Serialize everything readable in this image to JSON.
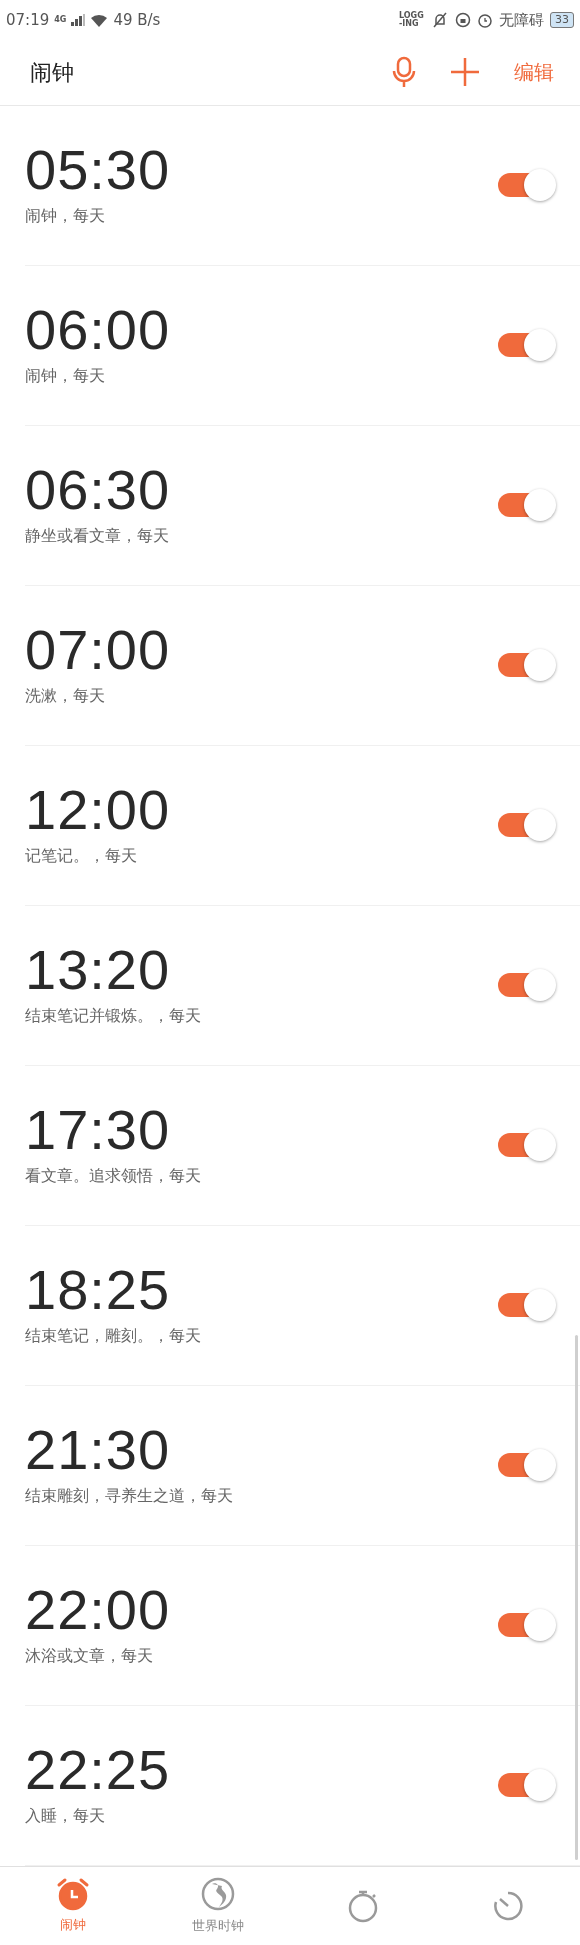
{
  "status_bar": {
    "time": "07:19",
    "network": "4G",
    "speed": "49 B/s",
    "logging": "LOGG-ING",
    "accessibility": "无障碍",
    "battery": "33"
  },
  "header": {
    "title": "闹钟",
    "edit": "编辑"
  },
  "alarms": [
    {
      "time": "05:30",
      "label": "闹钟，每天",
      "on": true
    },
    {
      "time": "06:00",
      "label": "闹钟，每天",
      "on": true
    },
    {
      "time": "06:30",
      "label": "静坐或看文章，每天",
      "on": true
    },
    {
      "time": "07:00",
      "label": "洗漱，每天",
      "on": true
    },
    {
      "time": "12:00",
      "label": "记笔记。，每天",
      "on": true
    },
    {
      "time": "13:20",
      "label": "结束笔记并锻炼。，每天",
      "on": true
    },
    {
      "time": "17:30",
      "label": "看文章。追求领悟，每天",
      "on": true
    },
    {
      "time": "18:25",
      "label": "结束笔记，雕刻。，每天",
      "on": true
    },
    {
      "time": "21:30",
      "label": "结束雕刻，寻养生之道，每天",
      "on": true
    },
    {
      "time": "22:00",
      "label": "沐浴或文章，每天",
      "on": true
    },
    {
      "time": "22:25",
      "label": "入睡，每天",
      "on": true
    }
  ],
  "tabs": [
    {
      "kind": "alarm",
      "label": "闹钟",
      "selected": true
    },
    {
      "kind": "world",
      "label": "世界时钟",
      "selected": false
    },
    {
      "kind": "stopwatch",
      "selected": false
    },
    {
      "kind": "timer",
      "selected": false
    }
  ]
}
